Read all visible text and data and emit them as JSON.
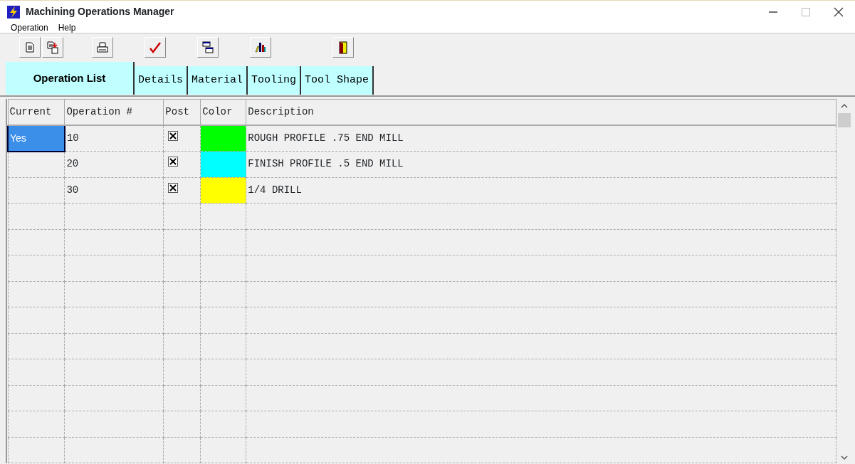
{
  "window": {
    "title": "Machining Operations Manager"
  },
  "menu": [
    "Operation",
    "Help"
  ],
  "toolbar": [
    {
      "kind": "page"
    },
    {
      "kind": "page-save"
    },
    {
      "kind": "printer"
    },
    {
      "kind": "check"
    },
    {
      "kind": "windows"
    },
    {
      "kind": "chart"
    },
    {
      "kind": "door"
    }
  ],
  "tabs": [
    {
      "label": "Operation List",
      "selected": true
    },
    {
      "label": "Details",
      "selected": false
    },
    {
      "label": "Material",
      "selected": false
    },
    {
      "label": "Tooling",
      "selected": false
    },
    {
      "label": "Tool Shape",
      "selected": false
    }
  ],
  "table": {
    "columns": [
      "Current",
      "Operation #",
      "Post",
      "Color",
      "Description"
    ],
    "rows": [
      {
        "current": "Yes",
        "selected": true,
        "operation": "10",
        "post": true,
        "color": "#00ff00",
        "description": "ROUGH PROFILE .75 END MILL"
      },
      {
        "selected": false,
        "operation": "20",
        "post": true,
        "color": "#00ffff",
        "description": "FINISH PROFILE .5 END MILL"
      },
      {
        "selected": false,
        "operation": "30",
        "post": true,
        "color": "#ffff00",
        "description": "1/4 DRILL"
      }
    ]
  }
}
